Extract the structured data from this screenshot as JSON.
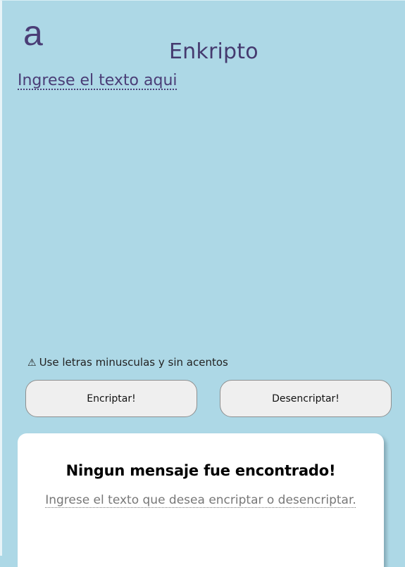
{
  "app": {
    "logo_text": "a",
    "title": "Enkripto"
  },
  "input": {
    "placeholder": "Ingrese el texto aqui",
    "value": ""
  },
  "warning": {
    "icon": "warning-icon",
    "symbol": "⚠",
    "text": "Use letras minusculas y sin acentos"
  },
  "buttons": {
    "encrypt_label": "Encriptar!",
    "decrypt_label": "Desencriptar!"
  },
  "result": {
    "title": "Ningun mensaje fue encontrado!",
    "text": "Ingrese el texto que desea encriptar o desencriptar."
  },
  "colors": {
    "background": "#add8e6",
    "brand": "#4a3d76",
    "button_background": "#efefef",
    "card_background": "#ffffff"
  }
}
